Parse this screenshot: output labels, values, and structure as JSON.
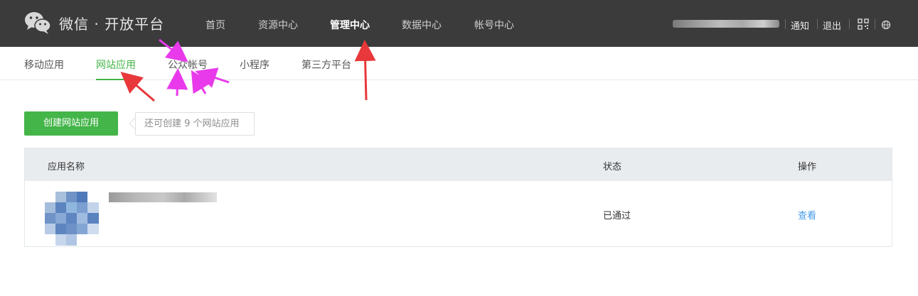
{
  "header": {
    "brand": "微信 · 开放平台",
    "nav": [
      "首页",
      "资源中心",
      "管理中心",
      "数据中心",
      "帐号中心"
    ],
    "active_nav": "管理中心",
    "links": {
      "notify": "通知",
      "logout": "退出"
    },
    "icons": [
      "wechat-logo",
      "qrcode-icon",
      "globe-icon"
    ],
    "bg_color": "#3b3b3b"
  },
  "subnav": {
    "items": [
      "移动应用",
      "网站应用",
      "公众帐号",
      "小程序",
      "第三方平台"
    ],
    "active": "网站应用",
    "accent_color": "#44b549"
  },
  "actions": {
    "create_label": "创建网站应用",
    "tip": "还可创建 9 个网站应用"
  },
  "table": {
    "headers": {
      "name": "应用名称",
      "status": "状态",
      "ops": "操作"
    },
    "rows": [
      {
        "status": "已通过",
        "action": "查看"
      }
    ],
    "link_color": "#459ae9"
  },
  "annotations": {
    "arrow_colors": [
      "#e8383b",
      "#e83aeb"
    ]
  }
}
